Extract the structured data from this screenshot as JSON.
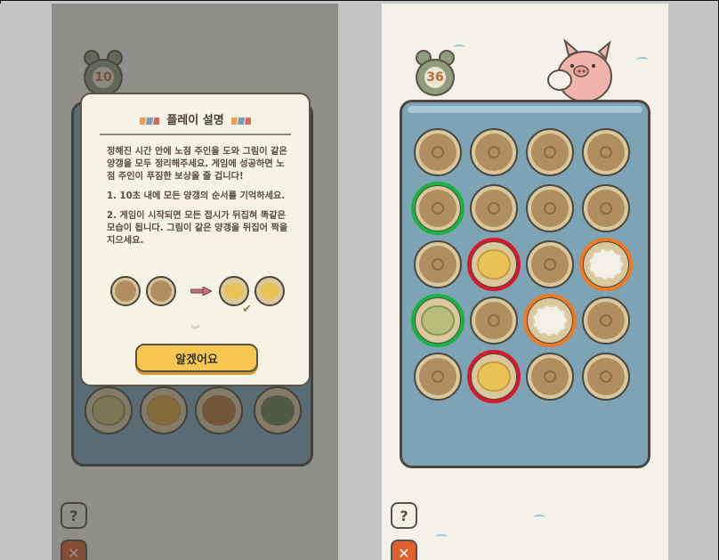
{
  "left": {
    "timer_value": "10",
    "modal": {
      "title": "플레이 설명",
      "intro": "정해진 시간 안에 노점 주인을 도와 그림이 같은 양갱을 모두 정리해주세요. 게임에 성공하면 노점 주인이 푸짐한 보상을 줄 겁니다!",
      "step1": "1. 10초 내에 모든 양갱의 순서를 기억하세요.",
      "step2": "2. 게임이 시작되면 모든 접시가 뒤집혀 똑같은 모습이 됩니다. 그림이 같은 양갱을 뒤집어 짝을 지으세요.",
      "confirm_button": "알겠어요"
    },
    "help_label": "?",
    "close_label": "✕"
  },
  "right": {
    "timer_value": "36",
    "help_label": "?",
    "close_label": "✕",
    "grid": [
      [
        "covered",
        "covered",
        "covered",
        "covered"
      ],
      [
        "covered",
        "covered",
        "covered",
        "covered"
      ],
      [
        "covered",
        "yellow",
        "covered",
        "white"
      ],
      [
        "green",
        "covered",
        "white",
        "covered"
      ],
      [
        "covered",
        "yellow",
        "covered",
        "covered"
      ]
    ],
    "highlights": [
      {
        "row": 1,
        "col": 0,
        "color": "green"
      },
      {
        "row": 2,
        "col": 1,
        "color": "red"
      },
      {
        "row": 2,
        "col": 3,
        "color": "orange"
      },
      {
        "row": 3,
        "col": 0,
        "color": "green"
      },
      {
        "row": 3,
        "col": 2,
        "color": "orange"
      },
      {
        "row": 4,
        "col": 1,
        "color": "red"
      }
    ]
  },
  "colors": {
    "highlight_green": "#1bb33f",
    "highlight_red": "#d7192b",
    "highlight_orange": "#f07a22",
    "button_yellow": "#f7c74f",
    "tray_blue": "#7da4b5"
  }
}
